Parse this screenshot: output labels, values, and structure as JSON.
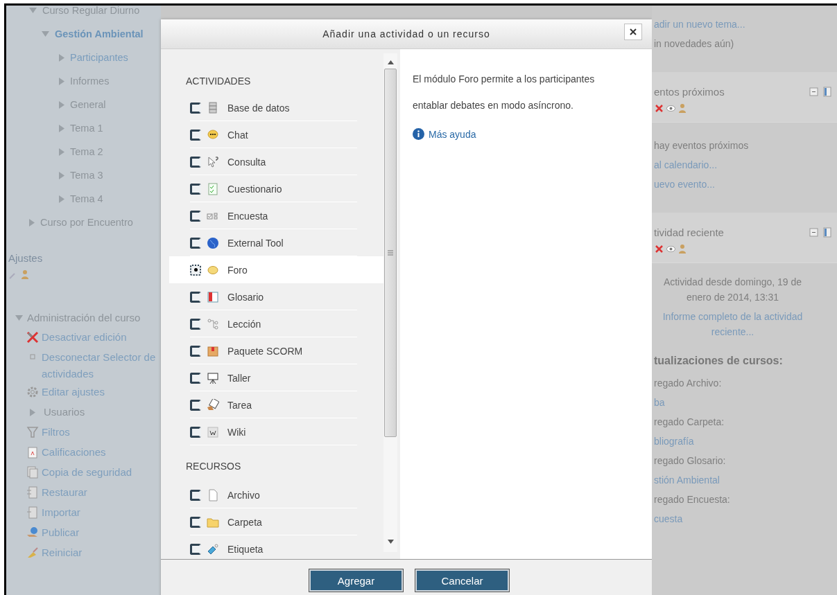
{
  "sidebar": {
    "nav": [
      {
        "label": "Curso Regular Diurno",
        "kind": "plain",
        "expanded": true,
        "children": [
          {
            "label": "Gestión Ambiental",
            "kind": "active",
            "expanded": true,
            "children": [
              {
                "label": "Participantes",
                "kind": "link",
                "expanded": false
              },
              {
                "label": "Informes",
                "kind": "plain",
                "expanded": false
              },
              {
                "label": "General",
                "kind": "plain",
                "expanded": false
              },
              {
                "label": "Tema 1",
                "kind": "plain",
                "expanded": false
              },
              {
                "label": "Tema 2",
                "kind": "plain",
                "expanded": false
              },
              {
                "label": "Tema 3",
                "kind": "plain",
                "expanded": false
              },
              {
                "label": "Tema 4",
                "kind": "plain",
                "expanded": false
              }
            ]
          }
        ]
      },
      {
        "label": "Curso por Encuentro",
        "kind": "plain",
        "expanded": false
      }
    ],
    "settings_title": "Ajustes",
    "admin": {
      "label": "Administración del curso",
      "expanded": true,
      "items": [
        {
          "label": "Desactivar edición",
          "kind": "link"
        },
        {
          "label": "Desconectar Selector de actividades",
          "kind": "link"
        },
        {
          "label": "Editar ajustes",
          "kind": "link"
        },
        {
          "label": "Usuarios",
          "kind": "branch"
        },
        {
          "label": "Filtros",
          "kind": "link"
        },
        {
          "label": "Calificaciones",
          "kind": "link"
        },
        {
          "label": "Copia de seguridad",
          "kind": "link"
        },
        {
          "label": "Restaurar",
          "kind": "link"
        },
        {
          "label": "Importar",
          "kind": "link"
        },
        {
          "label": "Publicar",
          "kind": "link"
        },
        {
          "label": "Reiniciar",
          "kind": "link"
        }
      ]
    }
  },
  "right": {
    "top_links": [
      {
        "text": "adir un nuevo tema...",
        "kind": "link"
      },
      {
        "text": "in novedades aún)",
        "kind": "plain"
      }
    ],
    "blocks": [
      {
        "title": "entos próximos",
        "lines": [
          {
            "text": "hay eventos próximos",
            "kind": "plain"
          },
          {
            "text": "al calendario...",
            "kind": "link"
          },
          {
            "text": "uevo evento...",
            "kind": "link"
          }
        ]
      },
      {
        "title": "tividad reciente",
        "lines": [
          {
            "text": "Actividad desde domingo, 19 de enero de 2014, 13:31",
            "kind": "center"
          },
          {
            "text": "Informe completo de la actividad reciente...",
            "kind": "centerlink"
          },
          {
            "text": "tualizaciones de cursos:",
            "kind": "heading"
          },
          {
            "text": "regado Archivo:",
            "kind": "plain"
          },
          {
            "text": "ba",
            "kind": "link"
          },
          {
            "text": "regado Carpeta:",
            "kind": "plain"
          },
          {
            "text": "bliografía",
            "kind": "link"
          },
          {
            "text": "regado Glosario:",
            "kind": "plain"
          },
          {
            "text": "stión Ambiental",
            "kind": "link"
          },
          {
            "text": "regado Encuesta:",
            "kind": "plain"
          },
          {
            "text": "cuesta",
            "kind": "link"
          }
        ]
      }
    ]
  },
  "dialog": {
    "title": "Añadir una actividad o un recurso",
    "sections": [
      {
        "title": "ACTIVIDADES",
        "items": [
          {
            "label": "Base de datos",
            "selected": false
          },
          {
            "label": "Chat",
            "selected": false
          },
          {
            "label": "Consulta",
            "selected": false
          },
          {
            "label": "Cuestionario",
            "selected": false
          },
          {
            "label": "Encuesta",
            "selected": false
          },
          {
            "label": "External Tool",
            "selected": false
          },
          {
            "label": "Foro",
            "selected": true
          },
          {
            "label": "Glosario",
            "selected": false
          },
          {
            "label": "Lección",
            "selected": false
          },
          {
            "label": "Paquete SCORM",
            "selected": false
          },
          {
            "label": "Taller",
            "selected": false
          },
          {
            "label": "Tarea",
            "selected": false
          },
          {
            "label": "Wiki",
            "selected": false
          }
        ]
      },
      {
        "title": "RECURSOS",
        "items": [
          {
            "label": "Archivo",
            "selected": false
          },
          {
            "label": "Carpeta",
            "selected": false
          },
          {
            "label": "Etiqueta",
            "selected": false
          }
        ]
      }
    ],
    "description": "El módulo Foro permite a los participantes entablar debates en modo asíncrono.",
    "help_link": "Más ayuda",
    "buttons": [
      "Agregar",
      "Cancelar"
    ]
  }
}
